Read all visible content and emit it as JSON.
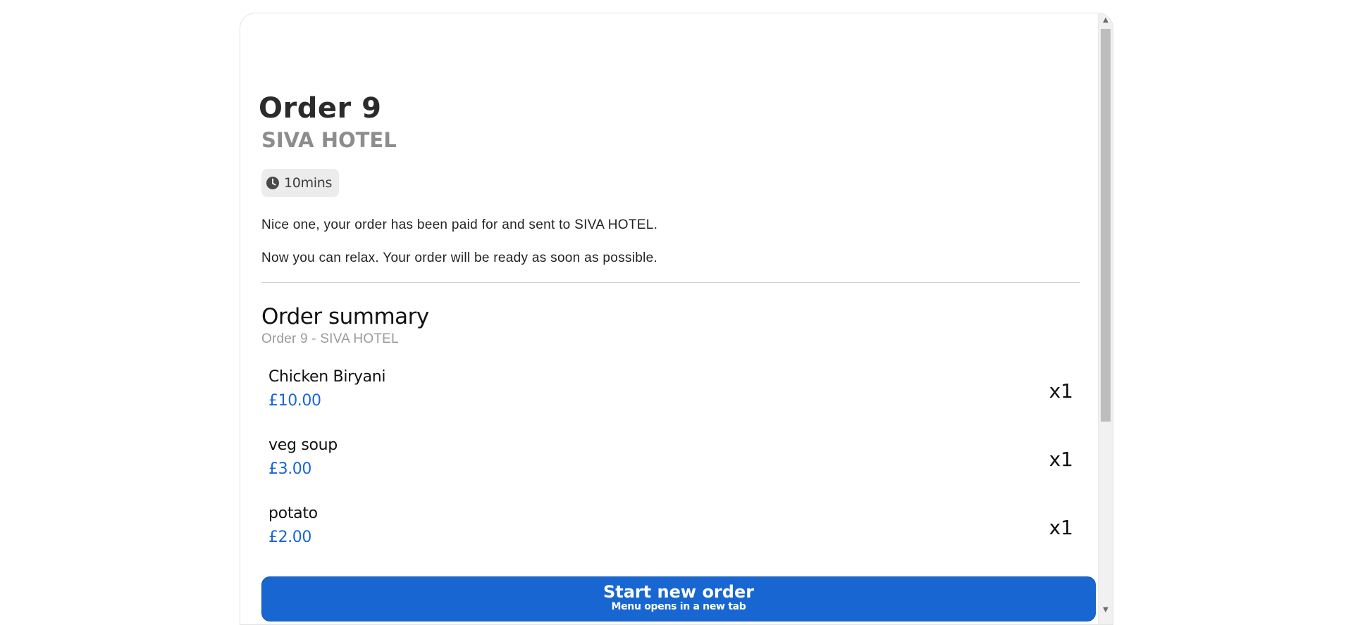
{
  "order": {
    "title": "Order 9",
    "restaurant": "SIVA HOTEL",
    "time_estimate": "10mins",
    "message_paid": "Nice one, your order has been paid for and sent to SIVA HOTEL.",
    "message_relax": "Now you can relax. Your order will be ready as soon as possible."
  },
  "summary": {
    "title": "Order summary",
    "subtitle": "Order 9 - SIVA HOTEL",
    "items": [
      {
        "name": "Chicken Biryani",
        "price": "£10.00",
        "qty": "x1"
      },
      {
        "name": "veg soup",
        "price": "£3.00",
        "qty": "x1"
      },
      {
        "name": "potato",
        "price": "£2.00",
        "qty": "x1"
      }
    ]
  },
  "cta": {
    "label": "Start new order",
    "sublabel": "Menu opens in a new tab"
  },
  "icons": {
    "time": "clock-icon"
  },
  "colors": {
    "accent": "#1766d2",
    "price": "#1966d2",
    "muted": "#8d8d8d"
  }
}
